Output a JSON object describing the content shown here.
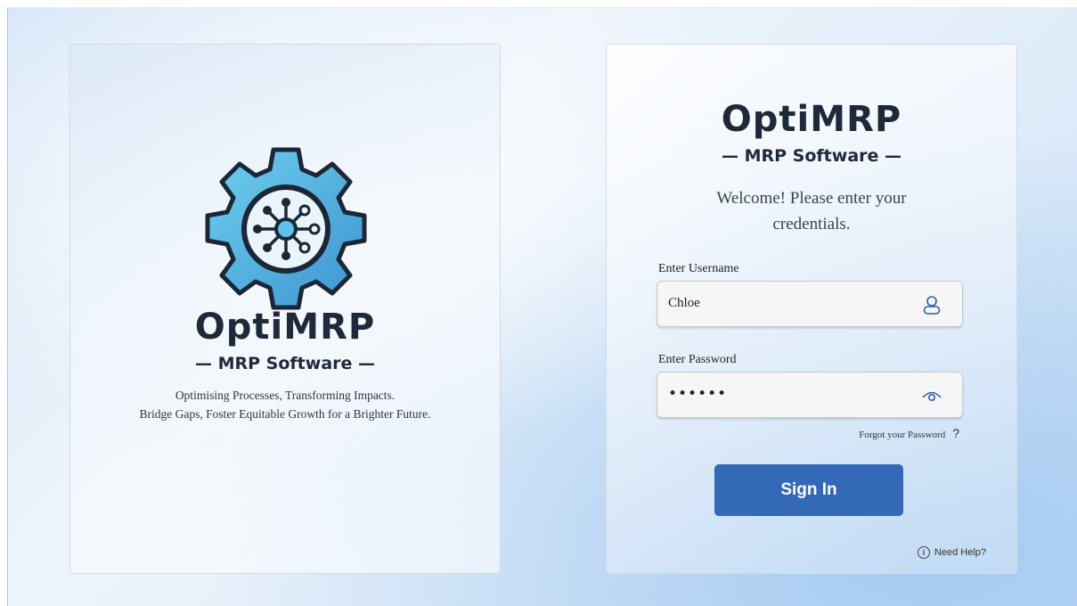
{
  "brand": {
    "name": "OptiMRP",
    "subtitle": "— MRP Software —"
  },
  "left_panel": {
    "tagline_line1": "Optimising Processes, Transforming Impacts.",
    "tagline_line2": "Bridge Gaps, Foster Equitable Growth for a Brighter Future.",
    "logo_icon": "gear-network-icon"
  },
  "login": {
    "welcome_line1": "Welcome! Please enter your",
    "welcome_line2": "credentials.",
    "username": {
      "label": "Enter Username",
      "value": "Chloe",
      "icon": "user-icon"
    },
    "password": {
      "label": "Enter Password",
      "value": "••••••",
      "icon": "eye-icon"
    },
    "forgot_label": "Forgot your Password",
    "forgot_mark": "?",
    "signin_label": "Sign In",
    "help_label": "Need Help?",
    "help_icon_glyph": "i"
  },
  "colors": {
    "primary_button": "#3469b7",
    "gear_fill": "#4fb3e0",
    "text_dark": "#1e2a3a"
  }
}
